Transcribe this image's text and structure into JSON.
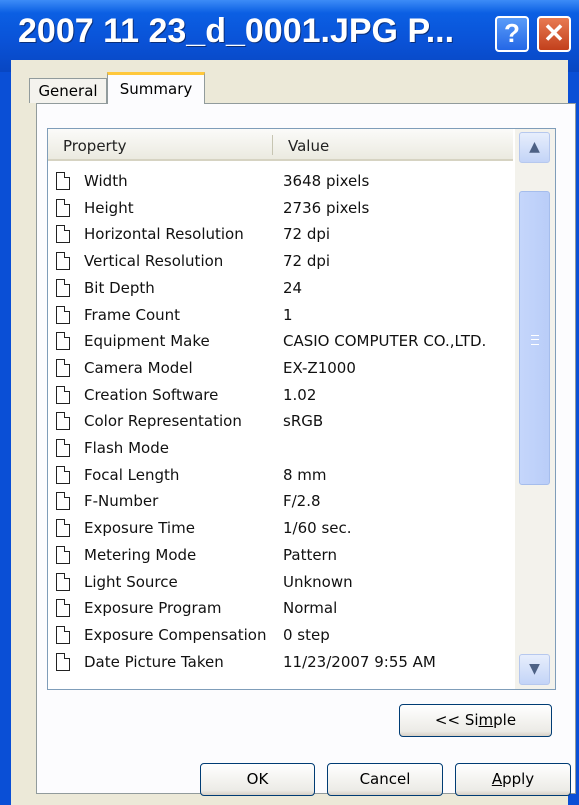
{
  "window": {
    "title": "2007 11 23_d_0001.JPG P...",
    "help_glyph": "?",
    "close_glyph": "✕"
  },
  "tabs": [
    {
      "label": "General"
    },
    {
      "label": "Summary"
    }
  ],
  "list": {
    "header": {
      "property": "Property",
      "value": "Value"
    },
    "rows": [
      {
        "property": "Width",
        "value": "3648 pixels"
      },
      {
        "property": "Height",
        "value": "2736 pixels"
      },
      {
        "property": "Horizontal Resolution",
        "value": "72 dpi"
      },
      {
        "property": "Vertical Resolution",
        "value": "72 dpi"
      },
      {
        "property": "Bit Depth",
        "value": "24"
      },
      {
        "property": "Frame Count",
        "value": "1"
      },
      {
        "property": "Equipment Make",
        "value": "CASIO COMPUTER CO.,LTD."
      },
      {
        "property": "Camera Model",
        "value": "EX-Z1000"
      },
      {
        "property": "Creation Software",
        "value": "1.02"
      },
      {
        "property": "Color Representation",
        "value": "sRGB"
      },
      {
        "property": "Flash Mode",
        "value": ""
      },
      {
        "property": "Focal Length",
        "value": "8 mm"
      },
      {
        "property": "F-Number",
        "value": "F/2.8"
      },
      {
        "property": "Exposure Time",
        "value": "1/60 sec."
      },
      {
        "property": "Metering Mode",
        "value": "Pattern"
      },
      {
        "property": "Light Source",
        "value": "Unknown"
      },
      {
        "property": "Exposure Program",
        "value": "Normal"
      },
      {
        "property": "Exposure Compensation",
        "value": "0 step"
      },
      {
        "property": "Date Picture Taken",
        "value": "11/23/2007 9:55 AM"
      }
    ]
  },
  "buttons": {
    "simple": "<< Simple",
    "ok": "OK",
    "cancel": "Cancel",
    "apply": "Apply"
  }
}
